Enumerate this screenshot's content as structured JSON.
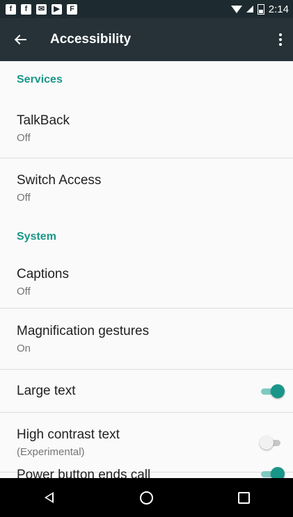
{
  "status_bar": {
    "notification_icons": [
      "facebook-icon",
      "facebook-icon",
      "mail-icon",
      "youtube-icon",
      "flipboard-icon"
    ],
    "notification_glyphs": [
      "f",
      "f",
      "✉",
      "▶",
      "F"
    ],
    "time": "2:14"
  },
  "toolbar": {
    "title": "Accessibility"
  },
  "sections": {
    "services": {
      "header": "Services",
      "talkback": {
        "title": "TalkBack",
        "summary": "Off"
      },
      "switch_access": {
        "title": "Switch Access",
        "summary": "Off"
      }
    },
    "system": {
      "header": "System",
      "captions": {
        "title": "Captions",
        "summary": "Off"
      },
      "magnification": {
        "title": "Magnification gestures",
        "summary": "On"
      },
      "large_text": {
        "title": "Large text",
        "checked": true
      },
      "high_contrast": {
        "title": "High contrast text",
        "summary": "(Experimental)",
        "checked": false
      },
      "power_button": {
        "title": "Power button ends call",
        "checked": true
      }
    }
  },
  "colors": {
    "accent": "#199688",
    "toolbar": "#263238",
    "status_bar": "#1d2a2f"
  }
}
